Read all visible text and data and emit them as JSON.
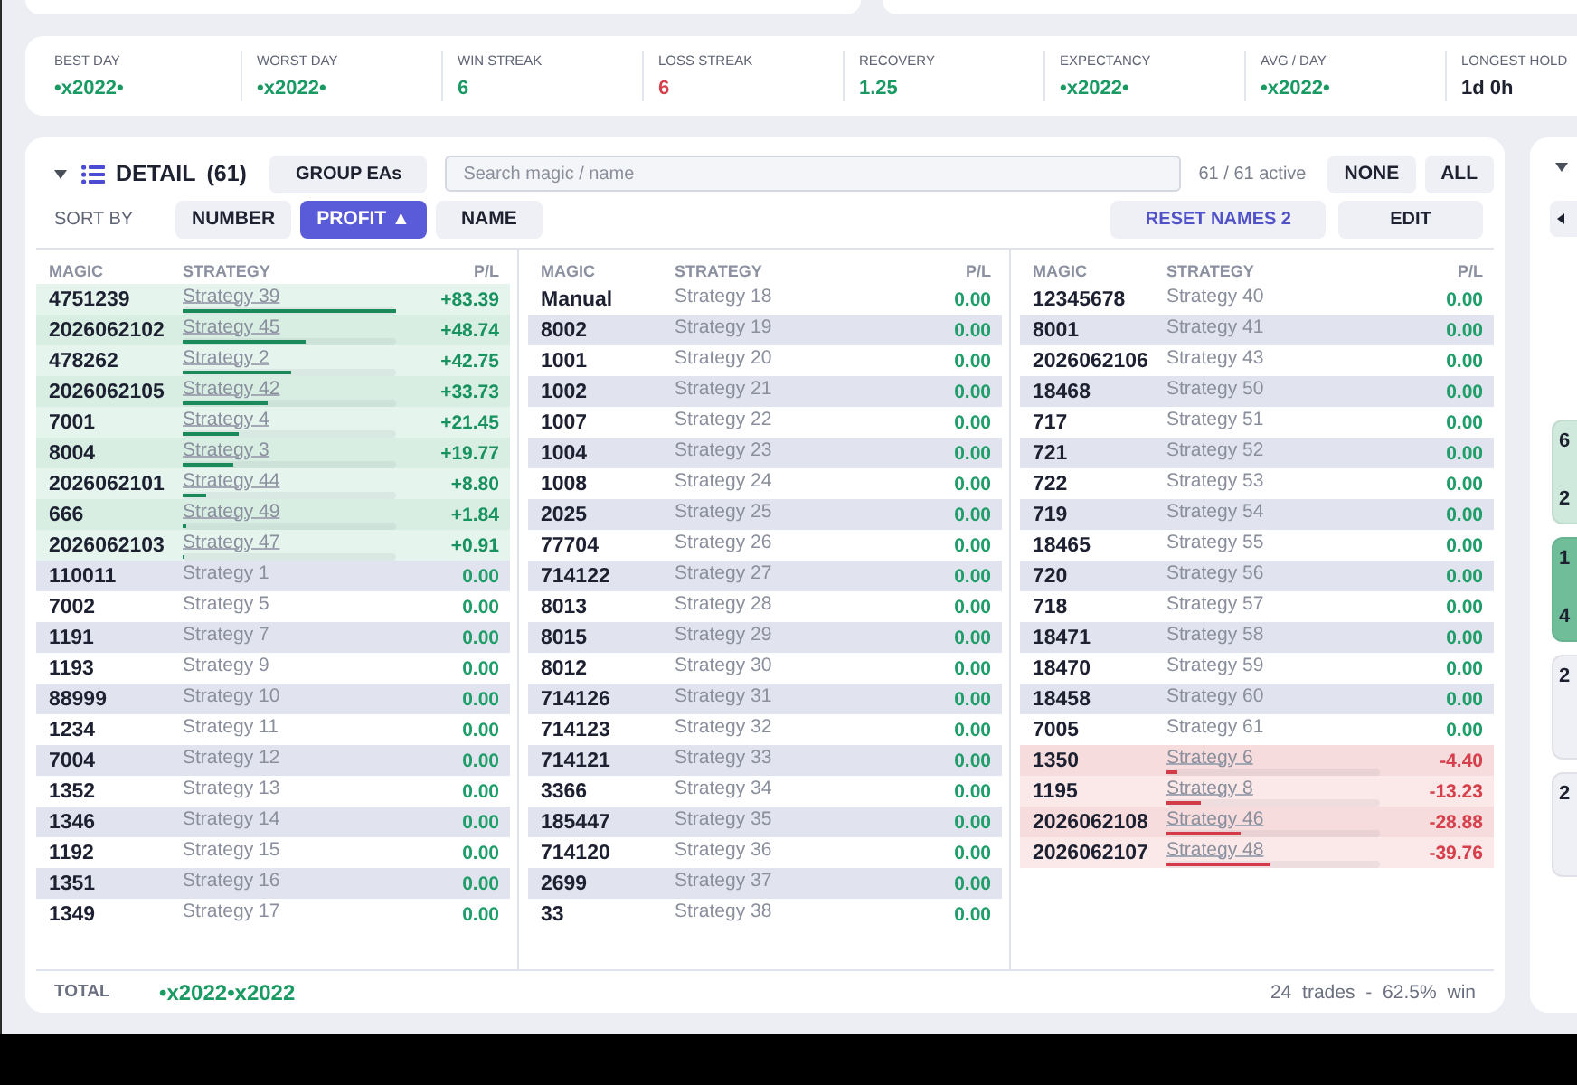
{
  "stats": [
    {
      "label": "BEST DAY",
      "value": "•x2022•",
      "kind": "gain"
    },
    {
      "label": "WORST DAY",
      "value": "•x2022•",
      "kind": "gain"
    },
    {
      "label": "WIN STREAK",
      "value": "6",
      "kind": "gain"
    },
    {
      "label": "LOSS STREAK",
      "value": "6",
      "kind": "loss"
    },
    {
      "label": "RECOVERY",
      "value": "1.25",
      "kind": "gain"
    },
    {
      "label": "EXPECTANCY",
      "value": "•x2022•",
      "kind": "gain"
    },
    {
      "label": "AVG / DAY",
      "value": "•x2022•",
      "kind": "gain"
    },
    {
      "label": "LONGEST HOLD",
      "value": "1d 0h",
      "kind": "plain"
    }
  ],
  "detail": {
    "expanded": true,
    "title": "DETAIL",
    "count": "(61)",
    "group_button": "GROUP EAs",
    "search": {
      "placeholder": "Search magic / name"
    },
    "active_count": "61 / 61 active",
    "select_buttons": [
      "NONE",
      "ALL"
    ],
    "sort_label": "SORT BY",
    "sort_options": [
      {
        "label": "NUMBER",
        "selected": false
      },
      {
        "label": "PROFIT ▲",
        "selected": true
      },
      {
        "label": "NAME",
        "selected": false
      }
    ],
    "reset_button": "RESET NAMES 2",
    "edit_button": "EDIT",
    "columns": [
      {
        "headers": [
          "MAGIC",
          "STRATEGY",
          "P/L"
        ],
        "rows": [
          {
            "magic": "4751239",
            "strategy": "Strategy 39",
            "pl": "+83.39",
            "kind": "gain",
            "level": 1
          },
          {
            "magic": "2026062102",
            "strategy": "Strategy 45",
            "pl": "+48.74",
            "kind": "gain",
            "level": 0.58
          },
          {
            "magic": "478262",
            "strategy": "Strategy 2",
            "pl": "+42.75",
            "kind": "gain",
            "level": 0.51
          },
          {
            "magic": "2026062105",
            "strategy": "Strategy 42",
            "pl": "+33.73",
            "kind": "gain",
            "level": 0.4
          },
          {
            "magic": "7001",
            "strategy": "Strategy 4",
            "pl": "+21.45",
            "kind": "gain",
            "level": 0.26
          },
          {
            "magic": "8004",
            "strategy": "Strategy 3",
            "pl": "+19.77",
            "kind": "gain",
            "level": 0.24
          },
          {
            "magic": "2026062101",
            "strategy": "Strategy 44",
            "pl": "+8.80",
            "kind": "gain",
            "level": 0.11
          },
          {
            "magic": "666",
            "strategy": "Strategy 49",
            "pl": "+1.84",
            "kind": "gain",
            "level": 0.02
          },
          {
            "magic": "2026062103",
            "strategy": "Strategy 47",
            "pl": "+0.91",
            "kind": "gain",
            "level": 0.01
          },
          {
            "magic": "110011",
            "strategy": "Strategy 1",
            "pl": "0.00",
            "kind": "flat"
          },
          {
            "magic": "7002",
            "strategy": "Strategy 5",
            "pl": "0.00",
            "kind": "flat"
          },
          {
            "magic": "1191",
            "strategy": "Strategy 7",
            "pl": "0.00",
            "kind": "flat"
          },
          {
            "magic": "1193",
            "strategy": "Strategy 9",
            "pl": "0.00",
            "kind": "flat"
          },
          {
            "magic": "88999",
            "strategy": "Strategy 10",
            "pl": "0.00",
            "kind": "flat"
          },
          {
            "magic": "1234",
            "strategy": "Strategy 11",
            "pl": "0.00",
            "kind": "flat"
          },
          {
            "magic": "7004",
            "strategy": "Strategy 12",
            "pl": "0.00",
            "kind": "flat"
          },
          {
            "magic": "1352",
            "strategy": "Strategy 13",
            "pl": "0.00",
            "kind": "flat"
          },
          {
            "magic": "1346",
            "strategy": "Strategy 14",
            "pl": "0.00",
            "kind": "flat"
          },
          {
            "magic": "1192",
            "strategy": "Strategy 15",
            "pl": "0.00",
            "kind": "flat"
          },
          {
            "magic": "1351",
            "strategy": "Strategy 16",
            "pl": "0.00",
            "kind": "flat"
          },
          {
            "magic": "1349",
            "strategy": "Strategy 17",
            "pl": "0.00",
            "kind": "flat"
          }
        ]
      },
      {
        "headers": [
          "MAGIC",
          "STRATEGY",
          "P/L"
        ],
        "rows": [
          {
            "magic": "Manual",
            "strategy": "Strategy 18",
            "pl": "0.00",
            "kind": "flat"
          },
          {
            "magic": "8002",
            "strategy": "Strategy 19",
            "pl": "0.00",
            "kind": "flat"
          },
          {
            "magic": "1001",
            "strategy": "Strategy 20",
            "pl": "0.00",
            "kind": "flat"
          },
          {
            "magic": "1002",
            "strategy": "Strategy 21",
            "pl": "0.00",
            "kind": "flat"
          },
          {
            "magic": "1007",
            "strategy": "Strategy 22",
            "pl": "0.00",
            "kind": "flat"
          },
          {
            "magic": "1004",
            "strategy": "Strategy 23",
            "pl": "0.00",
            "kind": "flat"
          },
          {
            "magic": "1008",
            "strategy": "Strategy 24",
            "pl": "0.00",
            "kind": "flat"
          },
          {
            "magic": "2025",
            "strategy": "Strategy 25",
            "pl": "0.00",
            "kind": "flat"
          },
          {
            "magic": "77704",
            "strategy": "Strategy 26",
            "pl": "0.00",
            "kind": "flat"
          },
          {
            "magic": "714122",
            "strategy": "Strategy 27",
            "pl": "0.00",
            "kind": "flat"
          },
          {
            "magic": "8013",
            "strategy": "Strategy 28",
            "pl": "0.00",
            "kind": "flat"
          },
          {
            "magic": "8015",
            "strategy": "Strategy 29",
            "pl": "0.00",
            "kind": "flat"
          },
          {
            "magic": "8012",
            "strategy": "Strategy 30",
            "pl": "0.00",
            "kind": "flat"
          },
          {
            "magic": "714126",
            "strategy": "Strategy 31",
            "pl": "0.00",
            "kind": "flat"
          },
          {
            "magic": "714123",
            "strategy": "Strategy 32",
            "pl": "0.00",
            "kind": "flat"
          },
          {
            "magic": "714121",
            "strategy": "Strategy 33",
            "pl": "0.00",
            "kind": "flat"
          },
          {
            "magic": "3366",
            "strategy": "Strategy 34",
            "pl": "0.00",
            "kind": "flat"
          },
          {
            "magic": "185447",
            "strategy": "Strategy 35",
            "pl": "0.00",
            "kind": "flat"
          },
          {
            "magic": "714120",
            "strategy": "Strategy 36",
            "pl": "0.00",
            "kind": "flat"
          },
          {
            "magic": "2699",
            "strategy": "Strategy 37",
            "pl": "0.00",
            "kind": "flat"
          },
          {
            "magic": "33",
            "strategy": "Strategy 38",
            "pl": "0.00",
            "kind": "flat"
          }
        ]
      },
      {
        "headers": [
          "MAGIC",
          "STRATEGY",
          "P/L"
        ],
        "rows": [
          {
            "magic": "12345678",
            "strategy": "Strategy 40",
            "pl": "0.00",
            "kind": "flat"
          },
          {
            "magic": "8001",
            "strategy": "Strategy 41",
            "pl": "0.00",
            "kind": "flat"
          },
          {
            "magic": "2026062106",
            "strategy": "Strategy 43",
            "pl": "0.00",
            "kind": "flat"
          },
          {
            "magic": "18468",
            "strategy": "Strategy 50",
            "pl": "0.00",
            "kind": "flat"
          },
          {
            "magic": "717",
            "strategy": "Strategy 51",
            "pl": "0.00",
            "kind": "flat"
          },
          {
            "magic": "721",
            "strategy": "Strategy 52",
            "pl": "0.00",
            "kind": "flat"
          },
          {
            "magic": "722",
            "strategy": "Strategy 53",
            "pl": "0.00",
            "kind": "flat"
          },
          {
            "magic": "719",
            "strategy": "Strategy 54",
            "pl": "0.00",
            "kind": "flat"
          },
          {
            "magic": "18465",
            "strategy": "Strategy 55",
            "pl": "0.00",
            "kind": "flat"
          },
          {
            "magic": "720",
            "strategy": "Strategy 56",
            "pl": "0.00",
            "kind": "flat"
          },
          {
            "magic": "718",
            "strategy": "Strategy 57",
            "pl": "0.00",
            "kind": "flat"
          },
          {
            "magic": "18471",
            "strategy": "Strategy 58",
            "pl": "0.00",
            "kind": "flat"
          },
          {
            "magic": "18470",
            "strategy": "Strategy 59",
            "pl": "0.00",
            "kind": "flat"
          },
          {
            "magic": "18458",
            "strategy": "Strategy 60",
            "pl": "0.00",
            "kind": "flat"
          },
          {
            "magic": "7005",
            "strategy": "Strategy 61",
            "pl": "0.00",
            "kind": "flat"
          },
          {
            "magic": "1350",
            "strategy": "Strategy 6",
            "pl": "-4.40",
            "kind": "loss",
            "level": 0.05
          },
          {
            "magic": "1195",
            "strategy": "Strategy 8",
            "pl": "-13.23",
            "kind": "loss",
            "level": 0.16
          },
          {
            "magic": "2026062108",
            "strategy": "Strategy 46",
            "pl": "-28.88",
            "kind": "loss",
            "level": 0.35
          },
          {
            "magic": "2026062107",
            "strategy": "Strategy 48",
            "pl": "-39.76",
            "kind": "loss",
            "level": 0.48
          }
        ]
      }
    ],
    "total": {
      "label": "TOTAL",
      "value": "•x2022•x2022",
      "summary": "24 trades - 62.5% win"
    }
  },
  "side_panel": {
    "expanded": true,
    "tiles": [
      {
        "lines": [
          "6",
          "2"
        ],
        "color": "#cfe9dc"
      },
      {
        "lines": [
          "1",
          "4"
        ],
        "color": "#6fbe99"
      },
      {
        "lines": [
          "2"
        ],
        "color": "#eef0f5"
      },
      {
        "lines": [
          "2"
        ],
        "color": "#eef0f5"
      }
    ]
  }
}
